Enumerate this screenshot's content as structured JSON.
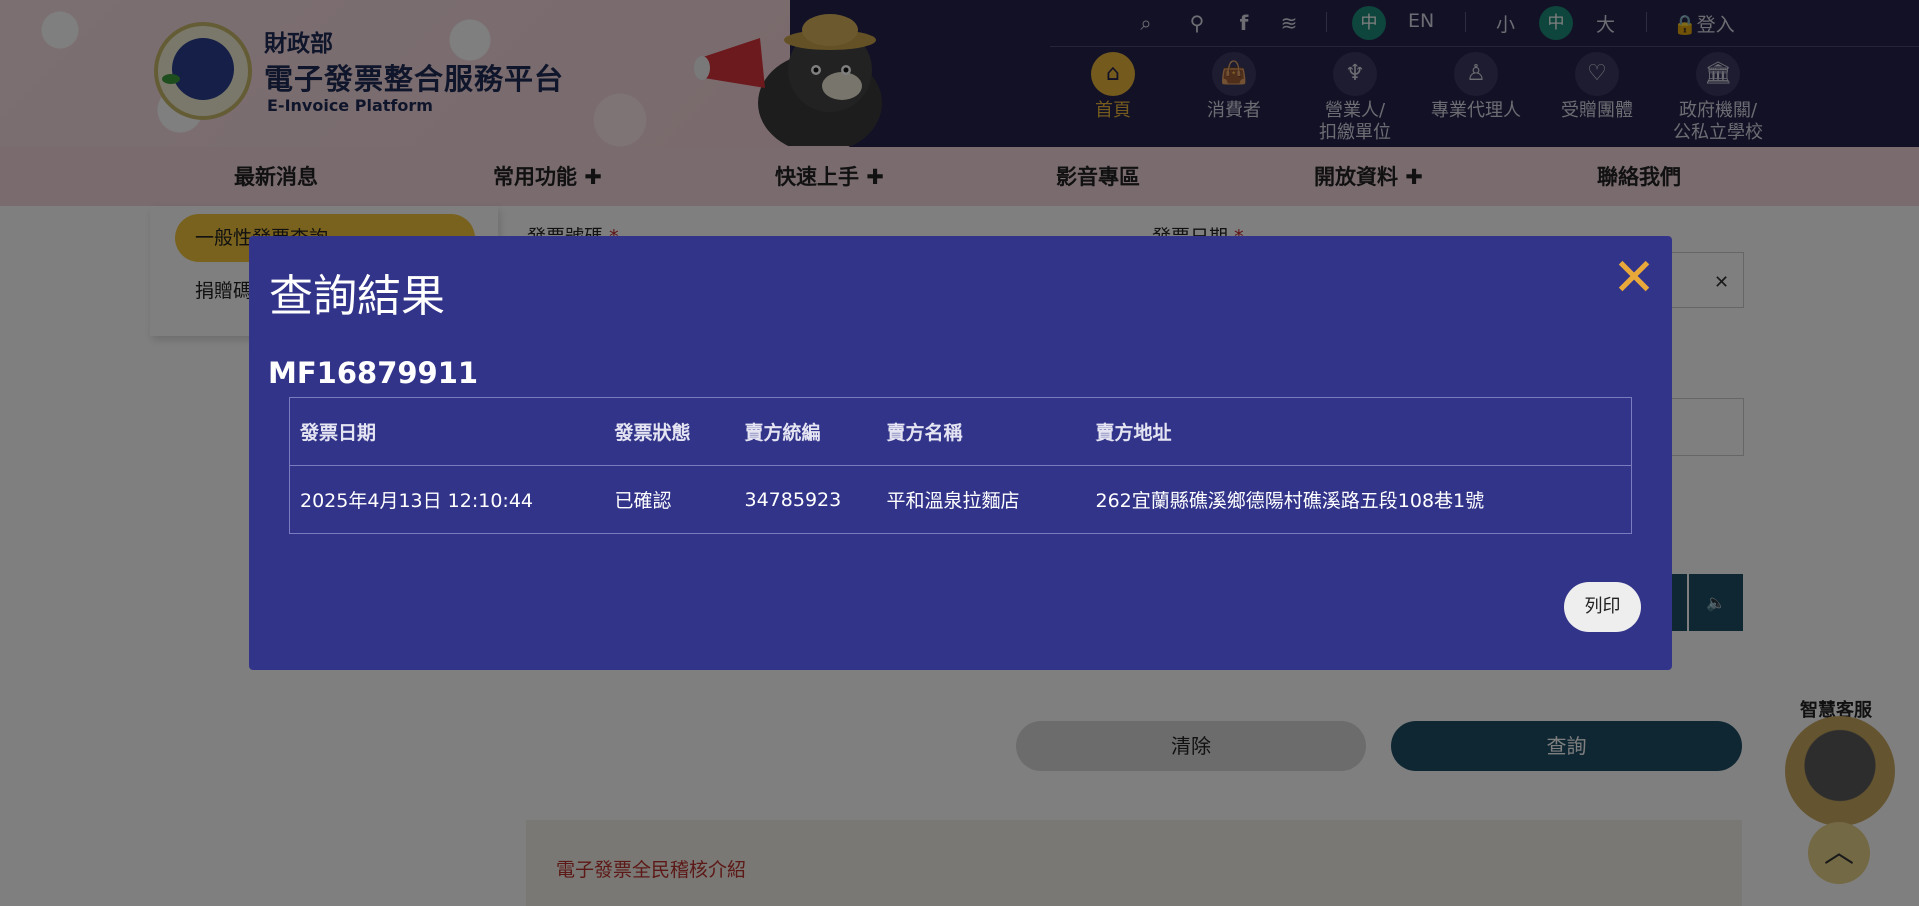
{
  "header": {
    "ministry": "財政部",
    "platform_name": "電子發票整合服務平台",
    "platform_en": "E-Invoice Platform",
    "lang_zh": "中",
    "lang_en": "EN",
    "font_small": "小",
    "font_mid": "中",
    "font_large": "大",
    "login": "登入",
    "nav": [
      {
        "label": "首頁",
        "icon": "home-icon",
        "active": true
      },
      {
        "label": "消費者",
        "icon": "shopping-bag-icon"
      },
      {
        "label": "營業人/\n扣繳單位",
        "icon": "tie-icon"
      },
      {
        "label": "專業代理人",
        "icon": "person-icon"
      },
      {
        "label": "受贈團體",
        "icon": "hand-heart-icon"
      },
      {
        "label": "政府機關/\n公私立學校",
        "icon": "building-icon"
      }
    ]
  },
  "menu": {
    "items": [
      "最新消息",
      "常用功能 ✚",
      "快速上手 ✚",
      "影音專區",
      "開放資料 ✚",
      "聯絡我們"
    ]
  },
  "page": {
    "sidebar_active": "一般性發票查詢",
    "sidebar_item": "捐贈碼",
    "label_invoice_no": "發票號碼",
    "label_invoice_date": "發票日期",
    "clear_button": "清除",
    "query_button": "查詢",
    "intro_link": "電子發票全民稽核介紹",
    "smart_service": "智慧客服"
  },
  "modal": {
    "title": "查詢結果",
    "close_glyph": "✕",
    "invoice_number": "MF16879911",
    "columns": [
      "發票日期",
      "發票狀態",
      "賣方統編",
      "賣方名稱",
      "賣方地址"
    ],
    "row": [
      "2025年4月13日 12:10:44",
      "已確認",
      "34785923",
      "平和溫泉拉麵店",
      "262宜蘭縣礁溪鄉德陽村礁溪路五段108巷1號"
    ],
    "print_button": "列印"
  },
  "colors": {
    "modal_bg": "#32348a",
    "header_dark": "#25234d",
    "accent_gold": "#e8b43a",
    "teal": "#1e4e66",
    "lang_active": "#1c8a78"
  }
}
